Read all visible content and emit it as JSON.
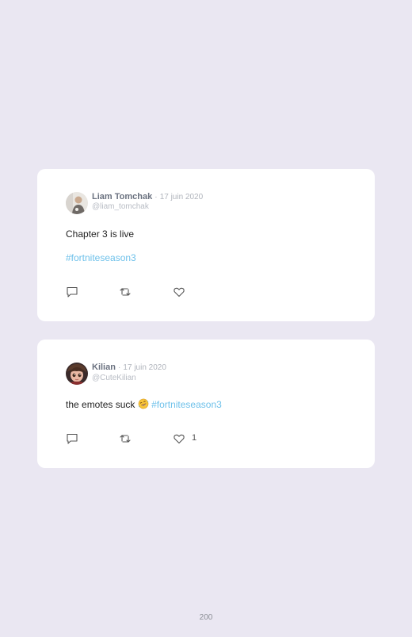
{
  "tweets": [
    {
      "name": "Liam Tomchak",
      "separator": "·",
      "date": "17 juin 2020",
      "handle": "@liam_tomchak",
      "text": "Chapter 3 is live",
      "hashtag": "#fortniteseason3",
      "like_count": ""
    },
    {
      "name": "Kilian",
      "separator": "·",
      "date": "17 juin 2020",
      "handle": "@CuteKilian",
      "text": "the emotes suck",
      "hashtag": "#fortniteseason3",
      "like_count": "1"
    }
  ],
  "icons": {
    "reply": "comment-icon",
    "retweet": "retweet-icon",
    "like": "heart-icon",
    "emoji": "rofl-emoji-icon"
  },
  "colors": {
    "background": "#eae7f2",
    "card": "#ffffff",
    "hashtag": "#6ec1ea"
  },
  "footer": {
    "page_number": "200"
  }
}
